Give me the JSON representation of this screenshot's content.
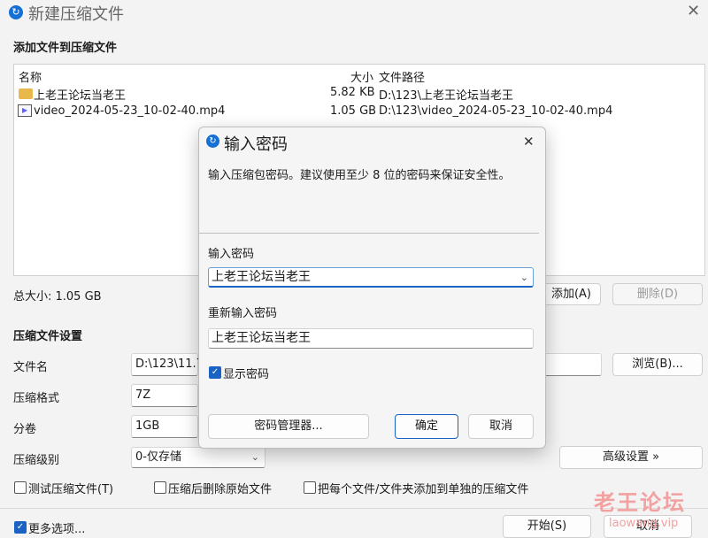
{
  "window": {
    "title": "新建压缩文件",
    "close_glyph": "✕",
    "icon_glyph": "↻"
  },
  "files_section": {
    "heading": "添加文件到压缩文件",
    "columns": {
      "name": "名称",
      "size": "大小",
      "path": "文件路径"
    },
    "rows": [
      {
        "name": "上老王论坛当老王",
        "size": "5.82 KB",
        "path": "D:\\123\\上老王论坛当老王",
        "icon": "folder-icon"
      },
      {
        "name": "video_2024-05-23_10-02-40.mp4",
        "size": "1.05 GB",
        "path": "D:\\123\\video_2024-05-23_10-02-40.mp4",
        "icon": "video-file-icon"
      }
    ],
    "total_size": "总大小: 1.05 GB",
    "add_button": "添加(A)",
    "delete_button": "删除(D)"
  },
  "settings": {
    "heading": "压缩文件设置",
    "filename_label": "文件名",
    "filename_value": "D:\\123\\11.7",
    "browse_button": "浏览(B)...",
    "format_label": "压缩格式",
    "format_value": "7Z",
    "volume_label": "分卷",
    "volume_value": "1GB",
    "level_label": "压缩级别",
    "level_value": "0-仅存储",
    "advanced_button": "高级设置 »",
    "test_checkbox": "测试压缩文件(T)",
    "delete_after_checkbox": "压缩后删除原始文件",
    "separate_checkbox": "把每个文件/文件夹添加到单独的压缩文件"
  },
  "footer": {
    "more_options": "更多选项...",
    "start_button": "开始(S)",
    "cancel_button": "取消"
  },
  "dialog": {
    "title": "输入密码",
    "close_glyph": "✕",
    "description": "输入压缩包密码。建议使用至少 8 位的密码来保证安全性。",
    "password_label": "输入密码",
    "password_value": "上老王论坛当老王",
    "confirm_label": "重新输入密码",
    "confirm_value": "上老王论坛当老王",
    "show_password": "显示密码",
    "manager_button": "密码管理器...",
    "ok_button": "确定",
    "cancel_button": "取消"
  },
  "watermark": {
    "text": "老王论坛",
    "url": "laowang.vip"
  },
  "colors": {
    "accent": "#1a63c4",
    "watermark": "#f2a0a0"
  }
}
